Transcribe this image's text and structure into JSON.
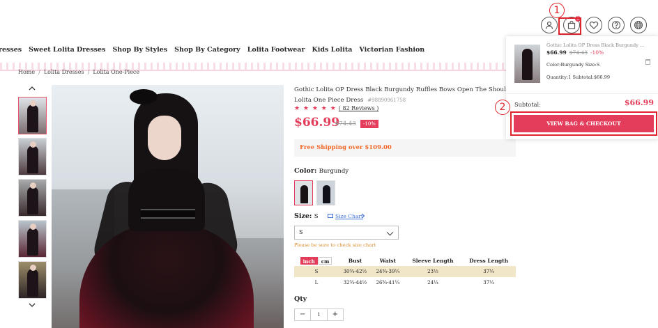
{
  "header": {
    "icons": [
      "user-icon",
      "bag-icon",
      "heart-icon",
      "help-icon",
      "globe-icon"
    ],
    "bag_count": "1",
    "step1": "1",
    "step2": "2"
  },
  "nav": {
    "items": [
      "resses",
      "Sweet Lolita Dresses",
      "Shop By Styles",
      "Shop By Category",
      "Lolita Footwear",
      "Kids Lolita",
      "Victorian Fashion"
    ]
  },
  "breadcrumb": [
    "Home",
    "Lolita Dresses",
    "Lolita One-Piece"
  ],
  "product": {
    "title": "Gothic Lolita OP Dress Black Burgundy Ruffles Bows Open The Shoulder Long Slee",
    "subtitle": "Lolita One Piece Dress",
    "sku": "#98890961758",
    "stars": "★ ★ ★ ★ ★",
    "reviews": "( 82 Reviews )",
    "price": "$66.99",
    "old_price": "$74.43",
    "discount": "-10%",
    "shipping": "Free Shipping over $109.00",
    "color_label": "Color:",
    "color_value": "Burgundy",
    "size_label": "Size:",
    "size_value": "S",
    "size_chart": "Size Chart",
    "size_selected": "S",
    "size_note": "Please be sure to check size chart",
    "qty_label": "Qty",
    "qty": "1",
    "qty_minus": "−",
    "qty_plus": "+"
  },
  "size_table": {
    "units": [
      "inch",
      "cm"
    ],
    "headers": [
      "Bust",
      "Waist",
      "Sleeve Length",
      "Dress Length"
    ],
    "rows": [
      {
        "size": "S",
        "bust": "30¾-42½",
        "waist": "24¾-39¼",
        "sleeve": "23½",
        "length": "37¼"
      },
      {
        "size": "L",
        "bust": "32¾-44½",
        "waist": "26¾-41¼",
        "sleeve": "24¼",
        "length": "37¼"
      }
    ]
  },
  "cart_popup": {
    "item_name": "Gothic Lolita OP Dress Black Burgundy ...",
    "price": "$66.99",
    "old_price": "$74.43",
    "discount": "-10%",
    "color_size": "Color:Burgundy   Size:S",
    "qty_subtotal": "Quantity:1    Subtotal:$66.99",
    "subtotal_label": "Subtotal:",
    "subtotal_value": "$66.99",
    "checkout": "VIEW BAG & CHECKOUT"
  },
  "colors": {
    "accent": "#e43d5b",
    "highlight_box": "#e0242b",
    "shipping_text": "#f2692b"
  }
}
